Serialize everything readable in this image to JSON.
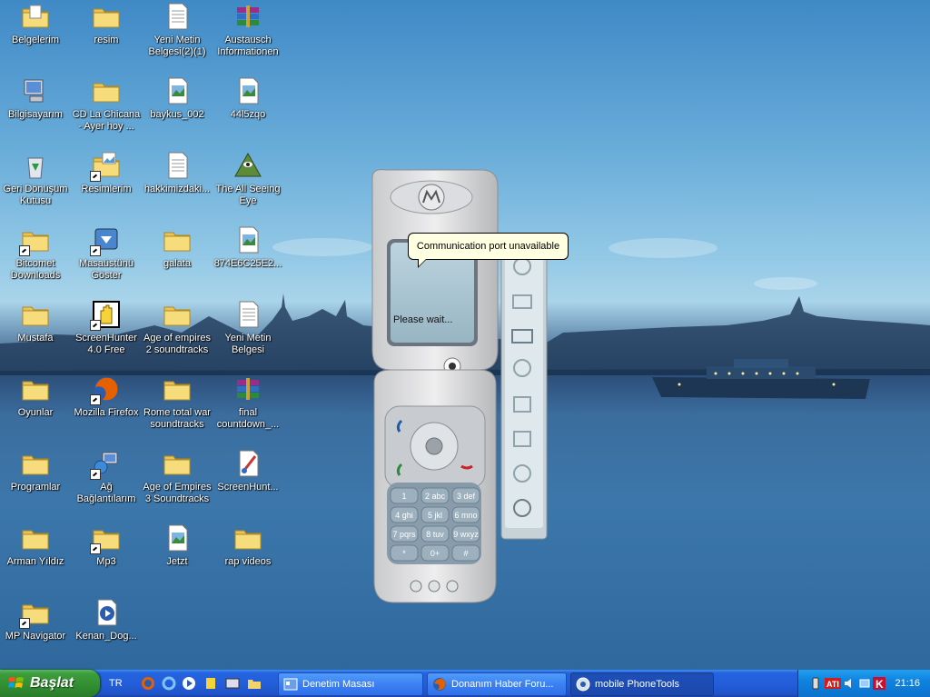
{
  "desktop": {
    "icons": [
      {
        "label": "Belgelerim",
        "icon": "my-documents-folder-icon"
      },
      {
        "label": "resim",
        "icon": "folder-icon"
      },
      {
        "label": "Yeni Metin Belgesi(2)(1)",
        "icon": "text-document-icon"
      },
      {
        "label": "Austausch Informationen",
        "icon": "winrar-archive-icon"
      },
      {
        "label": "Bilgisayarım",
        "icon": "my-computer-icon"
      },
      {
        "label": "CD La Chicana - Ayer hoy ...",
        "icon": "folder-icon"
      },
      {
        "label": "baykus_002",
        "icon": "image-file-icon"
      },
      {
        "label": "44l5zqo",
        "icon": "image-file-icon"
      },
      {
        "label": "Geri Dönüşüm Kutusu",
        "icon": "recycle-bin-icon"
      },
      {
        "label": "Resimlerim",
        "icon": "my-pictures-shortcut-icon"
      },
      {
        "label": "hakkimizdaki...",
        "icon": "document-file-icon"
      },
      {
        "label": "The All Seeing Eye",
        "icon": "all-seeing-eye-icon"
      },
      {
        "label": "Bitcomet Downloads",
        "icon": "folder-shortcut-icon"
      },
      {
        "label": "Masaüstünü Göster",
        "icon": "show-desktop-icon"
      },
      {
        "label": "galata",
        "icon": "folder-icon"
      },
      {
        "label": "874E6C25E2...",
        "icon": "image-file-icon"
      },
      {
        "label": "Mustafa",
        "icon": "folder-icon"
      },
      {
        "label": "ScreenHunter 4.0 Free",
        "icon": "screenhunter-app-icon"
      },
      {
        "label": "Age of empires 2 soundtracks",
        "icon": "folder-icon"
      },
      {
        "label": "Yeni Metin Belgesi",
        "icon": "text-document-icon"
      },
      {
        "label": "Oyunlar",
        "icon": "folder-icon"
      },
      {
        "label": "Mozilla Firefox",
        "icon": "firefox-icon"
      },
      {
        "label": "Rome total war soundtracks",
        "icon": "folder-icon"
      },
      {
        "label": "final countdown_...",
        "icon": "winrar-archive-icon"
      },
      {
        "label": "Programlar",
        "icon": "folder-icon"
      },
      {
        "label": "Ağ Bağlantılarım",
        "icon": "network-connections-icon"
      },
      {
        "label": "Age of Empires 3 Soundtracks",
        "icon": "folder-icon"
      },
      {
        "label": "ScreenHunt...",
        "icon": "paint-file-icon"
      },
      {
        "label": "Arman Yıldız",
        "icon": "folder-icon"
      },
      {
        "label": "Mp3",
        "icon": "folder-shortcut-icon"
      },
      {
        "label": "Jetzt",
        "icon": "image-file-icon"
      },
      {
        "label": "rap videos",
        "icon": "folder-icon"
      },
      {
        "label": "MP Navigator",
        "icon": "folder-shortcut-icon"
      },
      {
        "label": "Kenan_Dog...",
        "icon": "media-file-icon"
      }
    ]
  },
  "phone_app": {
    "balloon_text": "Communication port unavailable",
    "screen_status": "Please wait...",
    "keypad": [
      "1",
      "2 abc",
      "3 def",
      "4 ghi",
      "5 jkl",
      "6 mno",
      "7 pqrs",
      "8 tuv",
      "9 wxyz",
      "*",
      "0+",
      "#"
    ]
  },
  "taskbar": {
    "start_label": "Başlat",
    "language": "TR",
    "tasks": [
      {
        "label": "Denetim Masası",
        "icon": "control-panel-icon",
        "active": false
      },
      {
        "label": "Donanım Haber Foru...",
        "icon": "firefox-icon",
        "active": false
      },
      {
        "label": "mobile PhoneTools",
        "icon": "phonetools-icon",
        "active": true
      }
    ],
    "clock": "21:16"
  },
  "colors": {
    "taskbar_blue": "#245edb",
    "start_green": "#318d31",
    "tray_blue": "#0f83e0",
    "balloon_bg": "#ffffe1"
  }
}
